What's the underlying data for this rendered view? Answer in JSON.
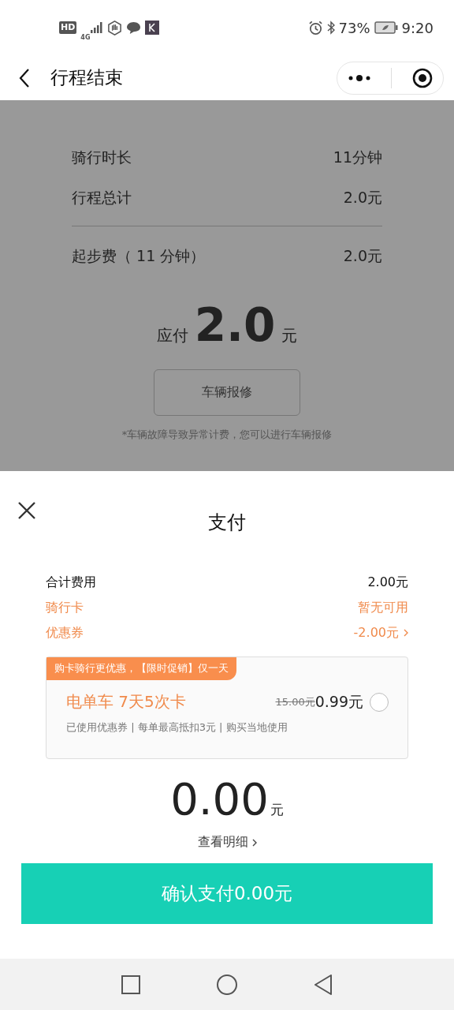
{
  "status_bar": {
    "network_badges": [
      "HD",
      "4G"
    ],
    "battery_percent": "73%",
    "time": "9:20"
  },
  "header": {
    "title": "行程结束"
  },
  "trip": {
    "summary": [
      {
        "label": "骑行时长",
        "value": "11分钟"
      },
      {
        "label": "行程总计",
        "value": "2.0元"
      }
    ],
    "fees": [
      {
        "label": "起步费（ 11 分钟）",
        "value": "2.0元"
      }
    ],
    "due_label": "应付",
    "due_amount": "2.0",
    "due_unit": "元",
    "repair_button": "车辆报修",
    "note": "*车辆故障导致异常计费，您可以进行车辆报修"
  },
  "payment": {
    "title": "支付",
    "lines": [
      {
        "label": "合计费用",
        "value": "2.00元",
        "kind": "plain"
      },
      {
        "label": "骑行卡",
        "value": "暂无可用",
        "kind": "accent"
      },
      {
        "label": "优惠券",
        "value": "-2.00元",
        "kind": "link"
      }
    ],
    "offer": {
      "banner": "购卡骑行更优惠，【限时促销】仅一天",
      "name": "电单车 7天5次卡",
      "old_price": "15.00元",
      "price": "0.99元",
      "selected": false,
      "details": "已使用优惠券 | 每单最高抵扣3元 | 购买当地使用"
    },
    "total": "0.00",
    "total_unit": "元",
    "details_link": "查看明细",
    "confirm_button": "确认支付0.00元"
  }
}
